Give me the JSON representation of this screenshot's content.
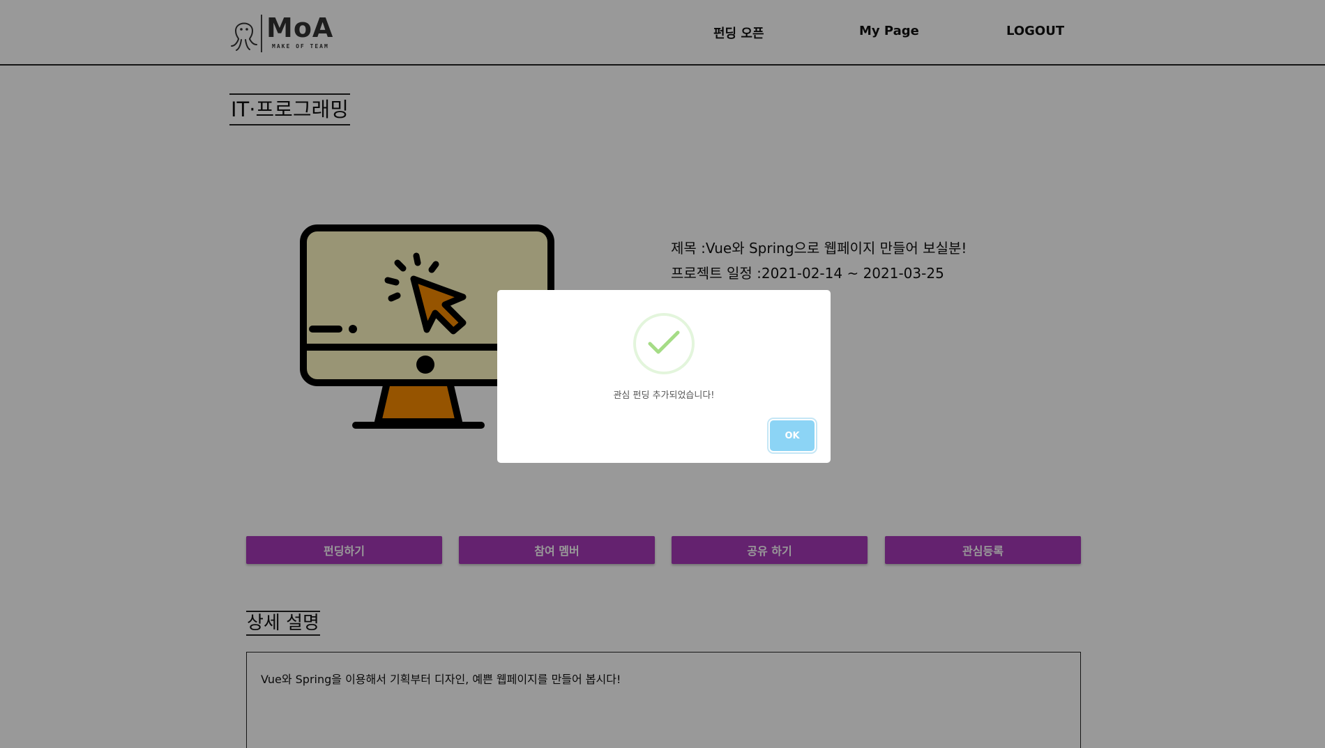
{
  "header": {
    "logo": {
      "wordmark": "MoA",
      "tagline": "MAKE OF TEAM"
    },
    "nav": [
      {
        "label": "펀딩 오픈"
      },
      {
        "label": "My Page"
      },
      {
        "label": "LOGOUT"
      }
    ]
  },
  "project": {
    "category": "IT·프로그래밍",
    "title_label": "제목 : ",
    "title": "Vue와 Spring으로 웹페이지 만들어 보실분!",
    "schedule_label": "프로젝트 일정 : ",
    "schedule": "2021-02-14 ~ 2021-03-25",
    "image_icon": "computer-monitor-click-icon"
  },
  "actions": [
    {
      "label": "펀딩하기"
    },
    {
      "label": "참여 멤버"
    },
    {
      "label": "공유 하기"
    },
    {
      "label": "관심등록"
    }
  ],
  "detail": {
    "title": "상세 설명",
    "text": "Vue와 Spring을 이용해서 기획부터 디자인, 예쁜 웹페이지를 만들어 봅시다!"
  },
  "modal": {
    "icon": "success-check-icon",
    "message": "관심 펀딩 추가되었습니다!",
    "ok_label": "OK"
  },
  "colors": {
    "accent": "#a73ab9",
    "ok_button": "#8cd4f5",
    "success": "#a5dc86",
    "overlay": "rgba(0,0,0,0.4)"
  }
}
